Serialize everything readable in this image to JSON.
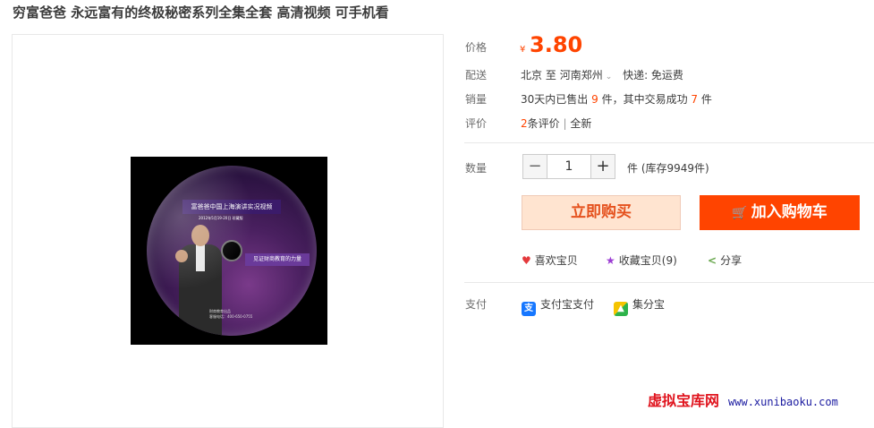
{
  "product": {
    "title": "穷富爸爸 永远富有的终极秘密系列全集全套 高清视频 可手机看"
  },
  "disc": {
    "banner": "富爸爸中国上海演讲实况视频",
    "subtitle": "2012年5月19-20日 珍藏版",
    "tagline": "见证财商教育的力量",
    "footer_line1": "财商教育出品",
    "footer_line2": "客服电话：400-650-0755"
  },
  "details": {
    "price_label": "价格",
    "currency": "¥",
    "price": "3.80",
    "shipping_label": "配送",
    "ship_from": "北京",
    "ship_to_word": "至",
    "ship_to": "河南郑州",
    "dropdown_icon": "chevron-down-icon",
    "express": "快递: 免运费",
    "sales_label": "销量",
    "sales_prefix": "30天内已售出",
    "sales_count": "9",
    "sales_mid": "件，其中交易成功",
    "sales_success": "7",
    "sales_suffix": "件",
    "review_label": "评价",
    "review_count": "2",
    "review_text": "条评价",
    "review_sep": "|",
    "review_new": "全新"
  },
  "quantity": {
    "label": "数量",
    "minus": "−",
    "value": "1",
    "plus": "+",
    "stock_text": "件 (库存9949件)"
  },
  "actions": {
    "buy_now": "立即购买",
    "add_to_cart": "加入购物车",
    "cart_icon": "🛒"
  },
  "social": {
    "like": "喜欢宝贝",
    "like_icon": "♥",
    "favorite": "收藏宝贝(9)",
    "favorite_icon": "★",
    "share": "分享",
    "share_icon": "<"
  },
  "payment": {
    "label": "支付",
    "alipay": "支付宝支付",
    "alipay_icon": "支",
    "jifen": "集分宝",
    "jifen_icon": "▲"
  },
  "watermark": {
    "text": "虚拟宝库网",
    "url": "www.xunibaoku.com"
  },
  "colors": {
    "accent": "#ff4400",
    "price": "#ff4400",
    "buy_bg": "#ffe4d0"
  }
}
